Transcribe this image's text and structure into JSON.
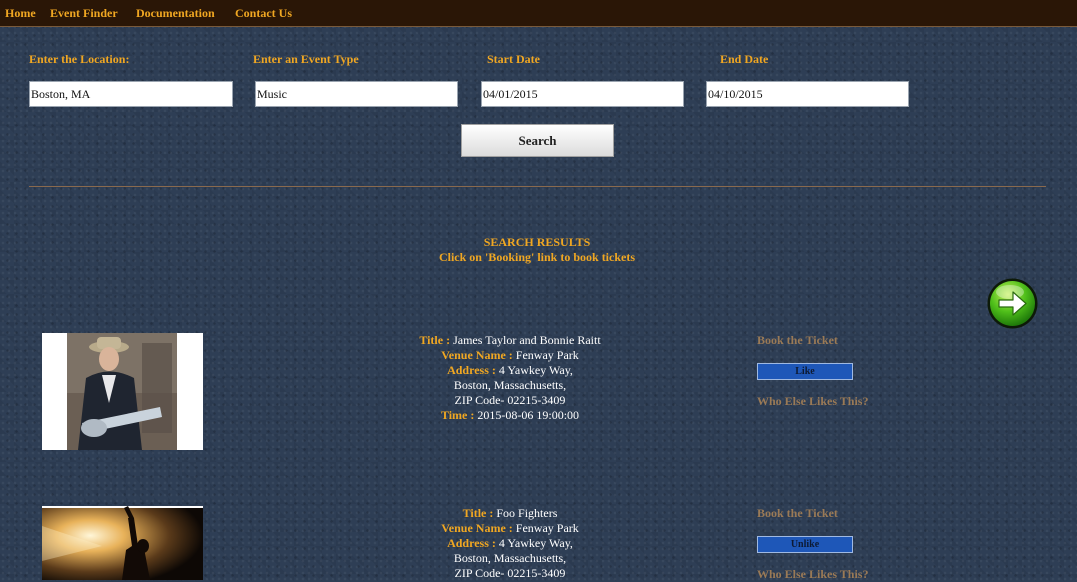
{
  "nav": {
    "home": "Home",
    "event_finder": "Event Finder",
    "documentation": "Documentation",
    "contact": "Contact Us"
  },
  "form": {
    "location_label": "Enter the Location:",
    "location_value": "Boston, MA",
    "event_type_label": "Enter an Event Type",
    "event_type_value": "Music",
    "start_label": "Start Date",
    "start_value": "04/01/2015",
    "end_label": "End Date",
    "end_value": "04/10/2015",
    "search_label": "Search"
  },
  "results": {
    "heading": "SEARCH RESULTS",
    "subheading": "Click on 'Booking' link to book tickets",
    "next_icon": "right-arrow-icon",
    "field_labels": {
      "title": "Title :",
      "venue": "Venue Name :",
      "address": "Address :",
      "time": "Time :"
    },
    "events": [
      {
        "title": "James Taylor and Bonnie Raitt",
        "venue": "Fenway Park",
        "address_line1": "4 Yawkey Way,",
        "address_line2": "Boston, Massachusetts,",
        "zip": "ZIP Code- 02215-3409",
        "time": "2015-08-06 19:00:00",
        "book_label": "Book the Ticket",
        "like_label": "Like",
        "who_likes_label": "Who Else Likes This?"
      },
      {
        "title": "Foo Fighters",
        "venue": "Fenway Park",
        "address_line1": "4 Yawkey Way,",
        "address_line2": "Boston, Massachusetts,",
        "zip": "ZIP Code- 02215-3409",
        "book_label": "Book the Ticket",
        "like_label": "Unlike",
        "who_likes_label": "Who Else Likes This?"
      }
    ]
  },
  "colors": {
    "accent": "#f0a722",
    "nav_bg": "#2a1606",
    "page_bg": "#2e3e55",
    "like_button": "#1e57b8",
    "muted_link": "#9a7a56"
  }
}
